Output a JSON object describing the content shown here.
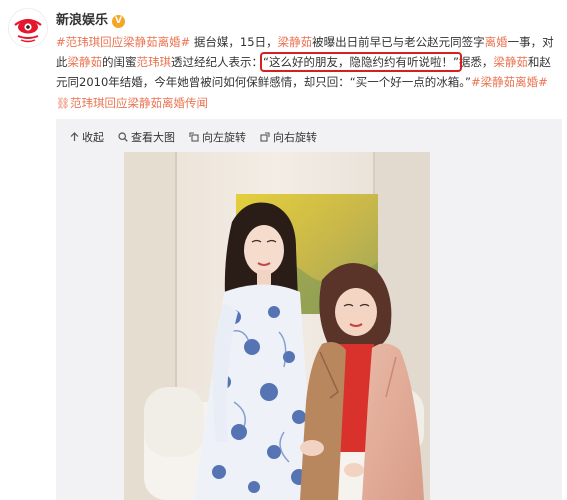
{
  "account": {
    "name": "新浪娱乐",
    "verified_mark": "V"
  },
  "post": {
    "tag1": "#范玮琪回应梁静茹离婚#",
    "t1": " 据台媒，15日，",
    "lk1": "梁静茹",
    "t2": "被曝出日前早已与老公赵元同签字",
    "lk2": "离婚",
    "t3": "一事，对此",
    "lk3": "梁静茹",
    "t4": "的闺蜜",
    "lk4": "范玮琪",
    "t5": "透过经纪人表示：",
    "quote": "“这么好的朋友，隐隐约约有听说啦！”",
    "t6": "据悉，",
    "lk5": "梁静茹",
    "t7": "和赵元同2010年结婚，今年她曾被问如何保鲜感情，却只回：“买一个好一点的冰箱。”",
    "tag2": "#梁静茹离婚#",
    "topic_link": "范玮琪回应梁静茹离婚传闻"
  },
  "toolbar": {
    "collapse": "收起",
    "view_large": "查看大图",
    "rotate_left": "向左旋转",
    "rotate_right": "向右旋转"
  },
  "colors": {
    "link": "#eb7350",
    "highlight_box": "#d62020",
    "verified": "#f6a623"
  },
  "icons": [
    "weibo-eye-logo-icon",
    "verified-icon",
    "link-icon",
    "collapse-icon",
    "zoom-icon",
    "rotate-left-icon",
    "rotate-right-icon"
  ]
}
